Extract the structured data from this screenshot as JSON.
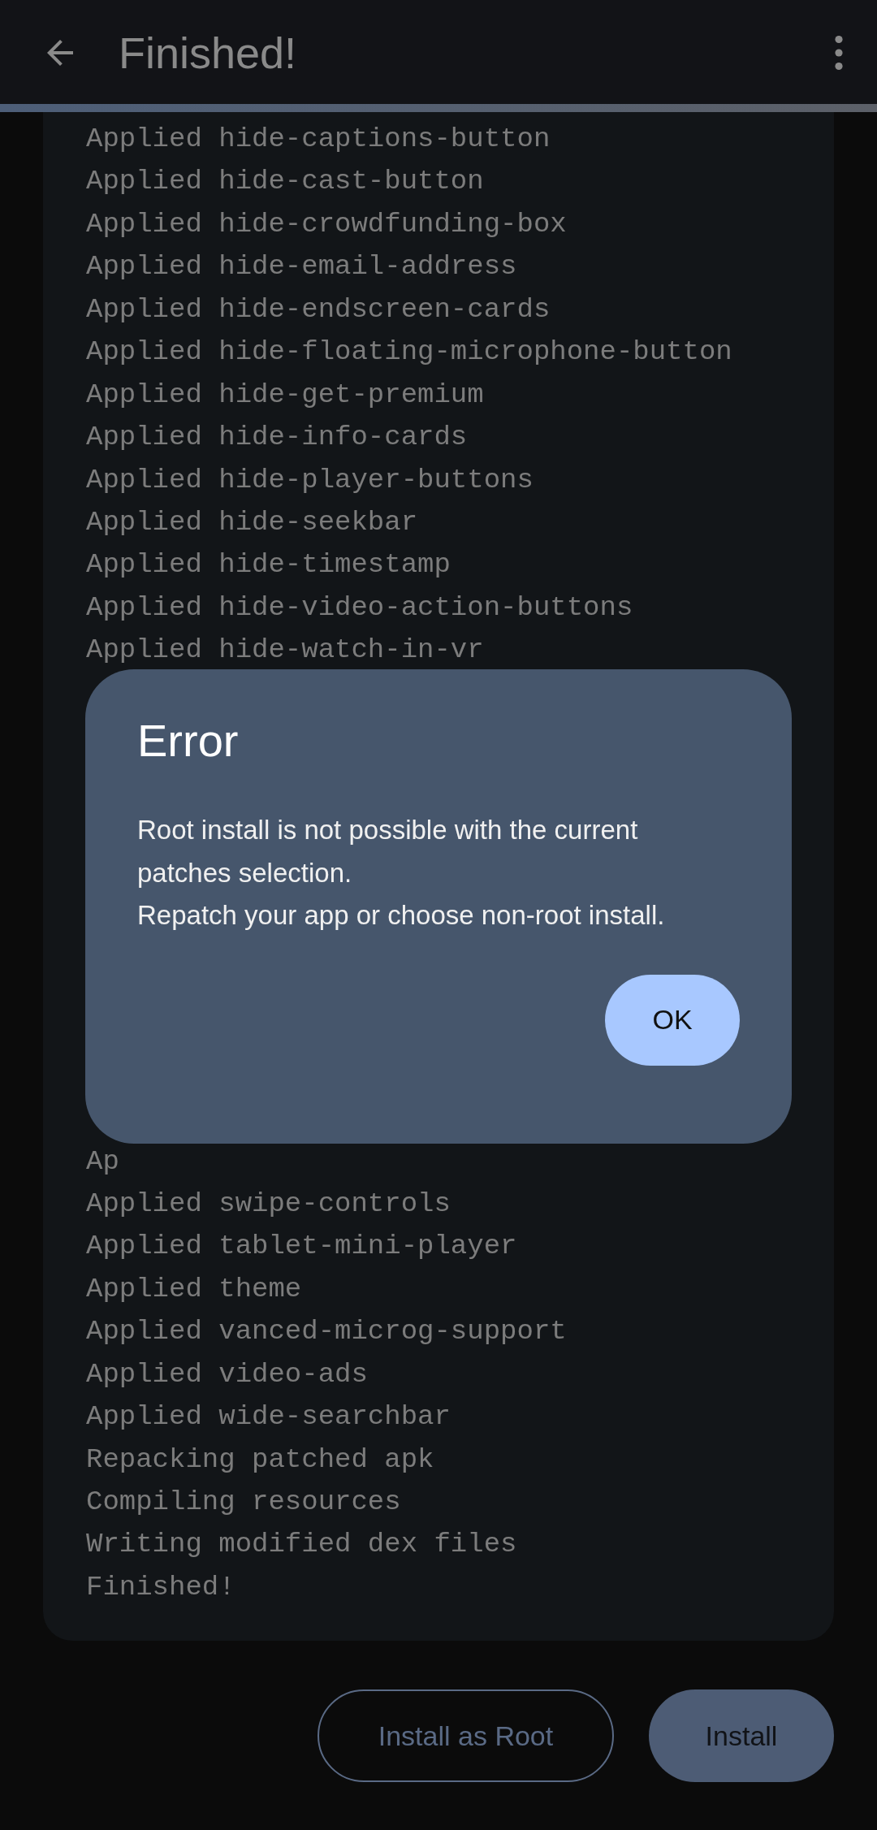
{
  "top_bar": {
    "title": "Finished!"
  },
  "progress": {
    "level": 1
  },
  "log": {
    "lines_above": [
      "Applied hide-captions-button",
      "Applied hide-cast-button",
      "Applied hide-crowdfunding-box",
      "Applied hide-email-address",
      "Applied hide-endscreen-cards",
      "Applied hide-floating-microphone-button",
      "Applied hide-get-premium",
      "Applied hide-info-cards",
      "Applied hide-player-buttons",
      "Applied hide-seekbar",
      "Applied hide-timestamp",
      "Applied hide-video-action-buttons",
      "Applied hide-watch-in-vr"
    ],
    "lines_below": [
      "Ap",
      "Applied swipe-controls",
      "Applied tablet-mini-player",
      "Applied theme",
      "Applied vanced-microg-support",
      "Applied video-ads",
      "Applied wide-searchbar",
      "Repacking patched apk",
      "Compiling resources",
      "Writing modified dex files",
      "Finished!"
    ]
  },
  "buttons": [
    {
      "label": "Install as Root",
      "kind": "outlined"
    },
    {
      "label": "Install",
      "kind": "filled"
    }
  ],
  "dialog": {
    "title": "Error",
    "message": [
      "Root install is not possible with the current patches selection.",
      "Repatch your app or choose non-root install."
    ],
    "button": "OK"
  }
}
